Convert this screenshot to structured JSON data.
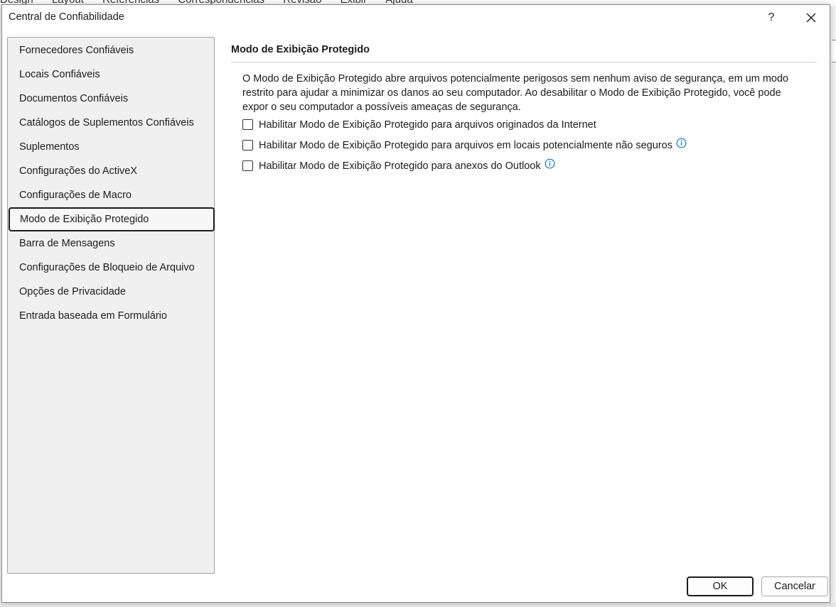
{
  "background_app": {
    "menu_items": [
      "Design",
      "Layout",
      "Referências",
      "Correspondências",
      "Revisão",
      "Exibir",
      "Ajuda"
    ]
  },
  "dialog": {
    "title": "Central de Confiabilidade",
    "help_label": "?",
    "ok_label": "OK",
    "cancel_label": "Cancelar"
  },
  "sidebar": {
    "items": [
      {
        "label": "Fornecedores Confiáveis"
      },
      {
        "label": "Locais Confiáveis"
      },
      {
        "label": "Documentos Confiáveis"
      },
      {
        "label": "Catálogos de Suplementos Confiáveis"
      },
      {
        "label": "Suplementos"
      },
      {
        "label": "Configurações do ActiveX"
      },
      {
        "label": "Configurações de Macro"
      },
      {
        "label": "Modo de Exibição Protegido",
        "selected": true
      },
      {
        "label": "Barra de Mensagens"
      },
      {
        "label": "Configurações de Bloqueio de Arquivo"
      },
      {
        "label": "Opções de Privacidade"
      },
      {
        "label": "Entrada baseada em Formulário"
      }
    ]
  },
  "main": {
    "section_title": "Modo de Exibição Protegido",
    "description": "O Modo de Exibição Protegido abre arquivos potencialmente perigosos sem nenhum aviso de segurança, em um modo restrito para ajudar a minimizar os danos ao seu computador. Ao desabilitar o Modo de Exibição Protegido, você pode expor o seu computador a possíveis ameaças de segurança.",
    "options": [
      {
        "label": "Habilitar Modo de Exibição Protegido para arquivos originados da Internet",
        "checked": false,
        "info_icon": false
      },
      {
        "label": "Habilitar Modo de Exibição Protegido para arquivos em locais potencialmente não seguros",
        "checked": false,
        "info_icon": true
      },
      {
        "label": "Habilitar Modo de Exibição Protegido para anexos do Outlook",
        "checked": false,
        "info_icon": true
      }
    ]
  },
  "colors": {
    "info_icon": "#0f6cbd",
    "selection_border": "#1b1b1b",
    "sidebar_bg": "#f0f0f0"
  }
}
